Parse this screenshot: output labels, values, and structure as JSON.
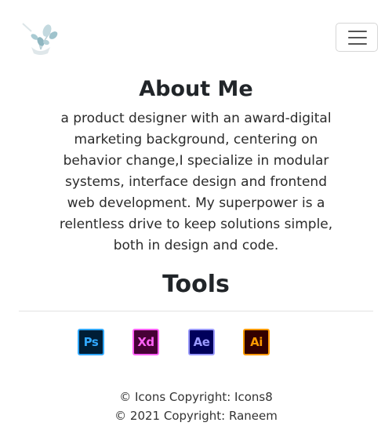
{
  "navbar": {
    "logo_icon": "plant-leaf-logo-icon",
    "menu_icon": "hamburger-menu-icon"
  },
  "about": {
    "title": "About Me",
    "text": "a product designer with an award-digital marketing background, centering on behavior change,I specialize in modular systems, interface design and frontend web development. My superpower is a relentless drive to keep solutions simple, both in design and code."
  },
  "tools": {
    "title": "Tools",
    "items": [
      {
        "label": "Ps",
        "icon": "photoshop-icon",
        "bg": "#001e36",
        "border": "#31a8ff",
        "color": "#31a8ff"
      },
      {
        "label": "Xd",
        "icon": "adobe-xd-icon",
        "bg": "#470137",
        "border": "#ff61f6",
        "color": "#ff61f6"
      },
      {
        "label": "Ae",
        "icon": "after-effects-icon",
        "bg": "#00005b",
        "border": "#9999ff",
        "color": "#9999ff"
      },
      {
        "label": "Ai",
        "icon": "illustrator-icon",
        "bg": "#330000",
        "border": "#ff9a00",
        "color": "#ff9a00"
      }
    ]
  },
  "footer": {
    "icons_copyright": "© Icons Copyright: Icons8",
    "copyright": "© 2021 Copyright: Raneem"
  }
}
